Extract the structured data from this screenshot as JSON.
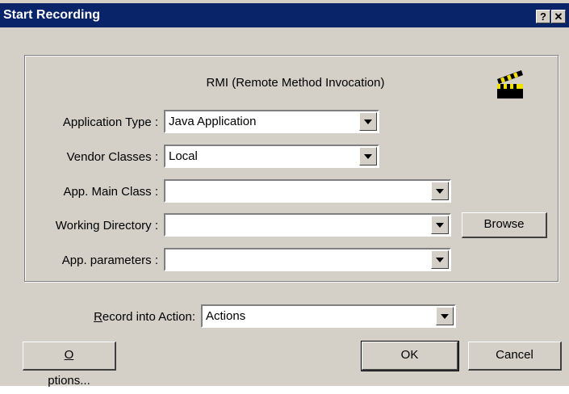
{
  "window": {
    "title": "Start Recording",
    "help_glyph": "?",
    "close_glyph": "✕"
  },
  "group": {
    "heading": "RMI (Remote Method Invocation)",
    "icon": "clapperboard-icon",
    "fields": {
      "app_type": {
        "label": "Application Type :",
        "value": "Java Application"
      },
      "vendor_classes": {
        "label": "Vendor Classes :",
        "value": "Local"
      },
      "main_class": {
        "label": "App. Main Class :",
        "value": ""
      },
      "working_dir": {
        "label": "Working Directory :",
        "value": ""
      },
      "app_params": {
        "label": "App. parameters :",
        "value": ""
      }
    },
    "browse_label": "Browse"
  },
  "record": {
    "label_first": "R",
    "label_rest": "ecord into Action:",
    "value": "Actions"
  },
  "buttons": {
    "options_first": "O",
    "options_rest": "ptions...",
    "ok": "OK",
    "cancel": "Cancel"
  }
}
